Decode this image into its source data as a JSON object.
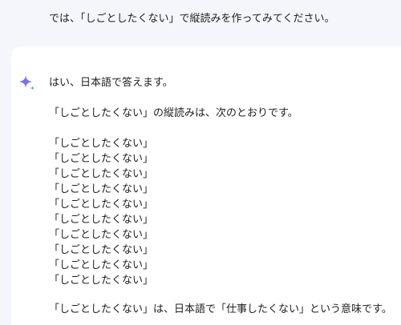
{
  "user_message": "では、「しごとしたくない」で縦読みを作ってみてください。",
  "response": {
    "intro": "はい、日本語で答えます。",
    "description": "「しごとしたくない」の縦読みは、次のとおりです。",
    "lines": [
      "「しごとしたくない」",
      "「しごとしたくない」",
      "「しごとしたくない」",
      "「しごとしたくない」",
      "「しごとしたくない」",
      "「しごとしたくない」",
      "「しごとしたくない」",
      "「しごとしたくない」",
      "「しごとしたくない」",
      "「しごとしたくない」"
    ],
    "closing": "「しごとしたくない」は、日本語で「仕事したくない」という意味です。"
  },
  "icons": {
    "assistant": "sparkle-icon"
  },
  "colors": {
    "page_background": "#f4f6fb",
    "card_background": "#ffffff",
    "sparkle_blue": "#4a7fe8",
    "sparkle_purple": "#a86be0"
  }
}
